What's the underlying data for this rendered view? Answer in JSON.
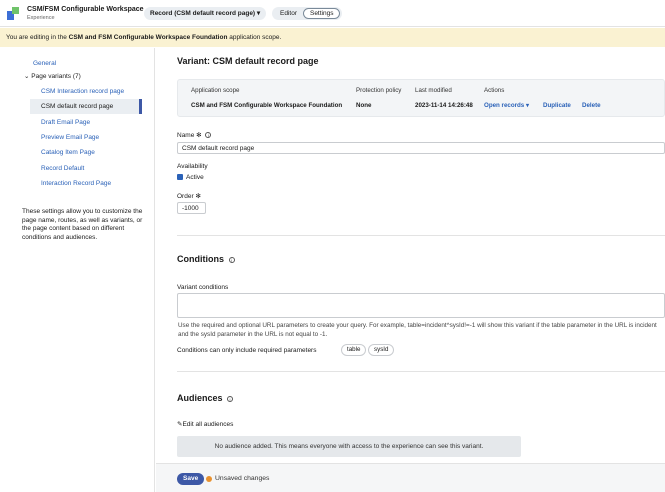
{
  "header": {
    "app_title": "CSM/FSM Configurable Workspace",
    "app_subtitle": "Experience",
    "page_select": "Record (CSM default record page)",
    "modes": [
      "Editor",
      "Settings"
    ]
  },
  "banner": {
    "prefix": "You are editing in the ",
    "scope": "CSM and FSM Configurable Workspace Foundation",
    "suffix": " application scope."
  },
  "sidebar": {
    "general": "General",
    "group": "Page variants (7)",
    "variants": [
      "CSM Interaction record page",
      "CSM default record page",
      "Draft Email Page",
      "Preview Email Page",
      "Catalog Item Page",
      "Record Default",
      "Interaction Record Page"
    ],
    "note": "These settings allow you to customize the page name, routes, as well as variants, or the page content based on different conditions and audiences."
  },
  "main": {
    "title": "Variant: CSM default record page",
    "info": {
      "headers": [
        "Application scope",
        "Protection policy",
        "Last modified",
        "Actions"
      ],
      "scope": "CSM and FSM Configurable Workspace Foundation",
      "policy": "None",
      "modified": "2023-11-14 14:26:48",
      "actions": [
        "Open records",
        "Duplicate",
        "Delete"
      ]
    },
    "name_label": "Name",
    "name_value": "CSM default record page",
    "availability_label": "Availability",
    "active_label": "Active",
    "order_label": "Order",
    "order_value": "-1000",
    "conditions_title": "Conditions",
    "variant_conditions_label": "Variant conditions",
    "help_text": "Use the required and optional URL parameters to create your query. For example, table=incident^sysId!=-1 will show this variant if the table parameter in the URL is incident and the sysId parameter in the URL is not equal to -1.",
    "required_params_label": "Conditions can only include required parameters",
    "params": [
      "table",
      "sysId"
    ],
    "audiences_title": "Audiences",
    "edit_audiences": "Edit all audiences",
    "no_audience": "No audience added. This means everyone with access to the experience can see this variant."
  },
  "footer": {
    "save": "Save",
    "unsaved": "Unsaved changes"
  },
  "colors": {
    "accent": "#3d58a6",
    "link": "#2b62b8",
    "banner_bg": "#faf2d2",
    "unsaved": "#e8912f"
  }
}
